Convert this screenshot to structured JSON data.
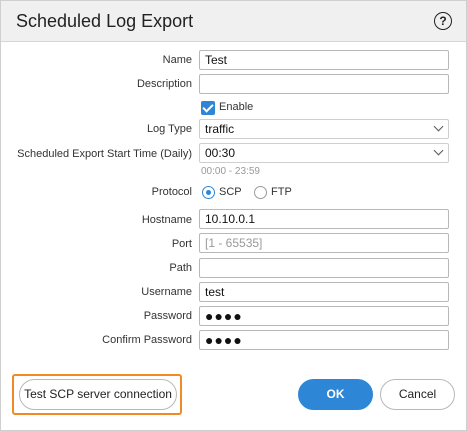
{
  "dialog": {
    "title": "Scheduled Log Export",
    "help_symbol": "?"
  },
  "form": {
    "name": {
      "label": "Name",
      "value": "Test"
    },
    "description": {
      "label": "Description",
      "value": ""
    },
    "enable": {
      "label": "Enable",
      "checked": true
    },
    "log_type": {
      "label": "Log Type",
      "value": "traffic"
    },
    "start_time": {
      "label": "Scheduled Export Start Time (Daily)",
      "value": "00:30",
      "hint": "00:00 - 23:59"
    },
    "protocol": {
      "label": "Protocol",
      "options": [
        "SCP",
        "FTP"
      ],
      "selected": "SCP"
    },
    "hostname": {
      "label": "Hostname",
      "value": "10.10.0.1"
    },
    "port": {
      "label": "Port",
      "placeholder": "[1 - 65535]"
    },
    "path": {
      "label": "Path",
      "value": ""
    },
    "username": {
      "label": "Username",
      "value": "test"
    },
    "password": {
      "label": "Password",
      "value": "●●●●"
    },
    "confirm_password": {
      "label": "Confirm Password",
      "value": "●●●●"
    }
  },
  "footer": {
    "test_button": "Test SCP server connection",
    "ok_button": "OK",
    "cancel_button": "Cancel"
  },
  "colors": {
    "accent": "#2e86d6",
    "highlight": "#f08a24"
  }
}
